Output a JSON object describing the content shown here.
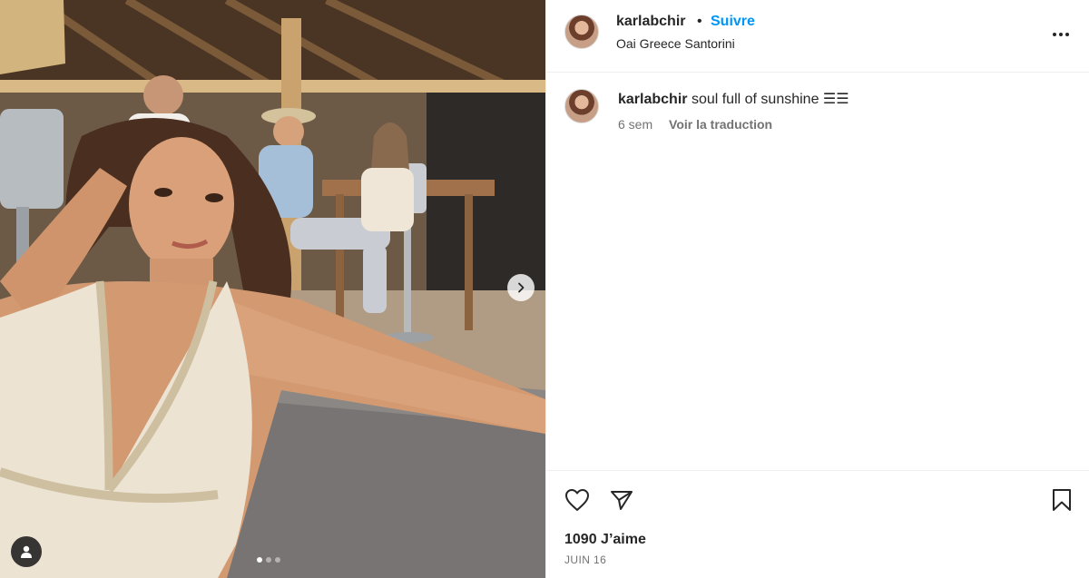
{
  "post": {
    "username": "karlabchir",
    "separator": "•",
    "follow_label": "Suivre",
    "location": "Oai Greece Santorini"
  },
  "caption": {
    "username": "karlabchir",
    "text": "soul full of sunshine",
    "emoji": "☰☰",
    "time_ago": "6 sem",
    "translate_label": "Voir la traduction"
  },
  "stats": {
    "likes": "1090 J’aime",
    "date": "JUIN 16"
  },
  "carousel": {
    "total_slides": 3,
    "current_slide": 1
  },
  "icons": {
    "more": "more-horizontal-icon",
    "like": "heart-icon",
    "share": "paper-plane-icon",
    "save": "bookmark-icon",
    "next": "chevron-right-icon",
    "tags": "user-tag-icon"
  },
  "colors": {
    "accent": "#0095f6",
    "text": "#262626",
    "secondary": "#737373",
    "divider": "#efefef"
  }
}
